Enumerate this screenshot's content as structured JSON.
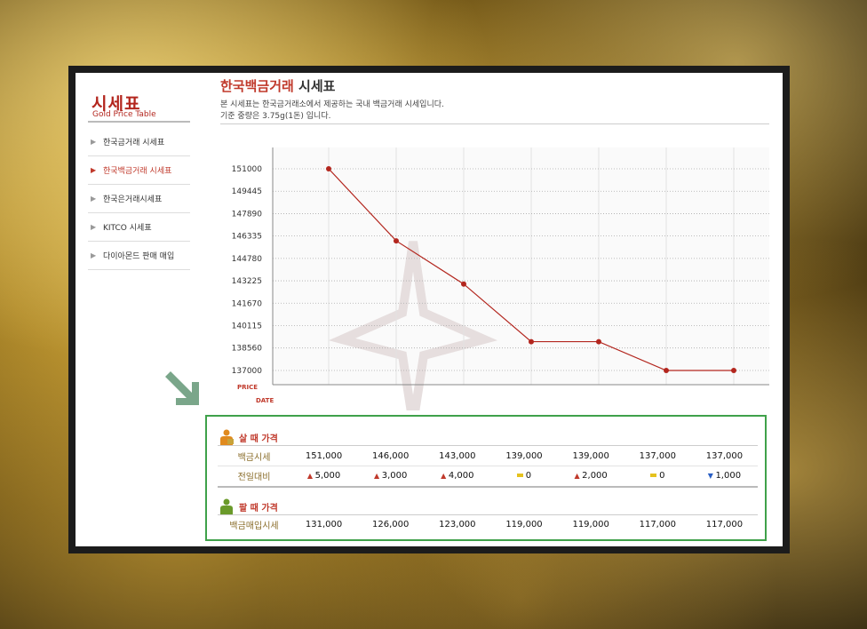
{
  "sidebar": {
    "title": "시세표",
    "subtitle": "Gold Price Table",
    "items": [
      {
        "label": "한국금거래 시세표",
        "active": false
      },
      {
        "label": "한국백금거래 시세표",
        "active": true
      },
      {
        "label": "한국은거래시세표",
        "active": false
      },
      {
        "label": "KITCO 시세표",
        "active": false
      },
      {
        "label": "다이아몬드 판매 매입",
        "active": false
      }
    ]
  },
  "header": {
    "title_accent": "한국백금거래",
    "title_rest": " 시세표",
    "desc_line1": "본 시세표는 한국금거래소에서 제공하는 국내 백금거래 시세입니다.",
    "desc_line2": "기준 중량은 3.75g(1돈) 입니다."
  },
  "chart_data": {
    "type": "line",
    "ylabel": "PRICE",
    "xlabel": "DATE",
    "yticks": [
      137000,
      138560,
      140115,
      141670,
      143225,
      144780,
      146335,
      147890,
      149445,
      151000
    ],
    "ylim": [
      137000,
      151000
    ],
    "grid": true,
    "line_color": "#b3261e",
    "series": [
      {
        "values": [
          151000,
          146000,
          143000,
          139000,
          139000,
          137000,
          137000
        ]
      }
    ]
  },
  "buy": {
    "title": "살 때 가격",
    "price_label": "백금시세",
    "prices": [
      "151,000",
      "146,000",
      "143,000",
      "139,000",
      "139,000",
      "137,000",
      "137,000"
    ],
    "change_label": "전일대비",
    "changes": [
      {
        "dir": "up",
        "value": "5,000"
      },
      {
        "dir": "up",
        "value": "3,000"
      },
      {
        "dir": "up",
        "value": "4,000"
      },
      {
        "dir": "flat",
        "value": "0"
      },
      {
        "dir": "up",
        "value": "2,000"
      },
      {
        "dir": "flat",
        "value": "0"
      },
      {
        "dir": "down",
        "value": "1,000"
      }
    ]
  },
  "sell": {
    "title": "팔 때 가격",
    "price_label": "백금매입시세",
    "prices": [
      "131,000",
      "126,000",
      "123,000",
      "119,000",
      "119,000",
      "117,000",
      "117,000"
    ]
  },
  "colors": {
    "accent": "#c0392b",
    "box_border": "#3fa14a",
    "arrow": "#7aa68a"
  }
}
